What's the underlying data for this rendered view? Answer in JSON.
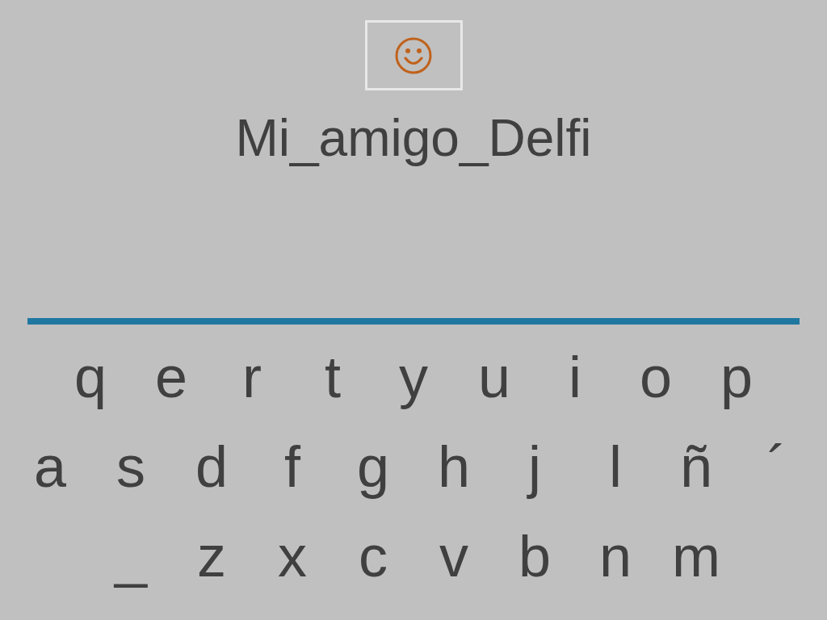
{
  "title": "Mi_amigo_Delfi",
  "keyboard": [
    [
      "q",
      "e",
      "r",
      "t",
      "y",
      "u",
      "i",
      "o",
      "p"
    ],
    [
      "a",
      "s",
      "d",
      "f",
      "g",
      "h",
      "j",
      "l",
      "ñ",
      "´"
    ],
    [
      "_",
      "z",
      "x",
      "c",
      "v",
      "b",
      "n",
      "m"
    ]
  ]
}
